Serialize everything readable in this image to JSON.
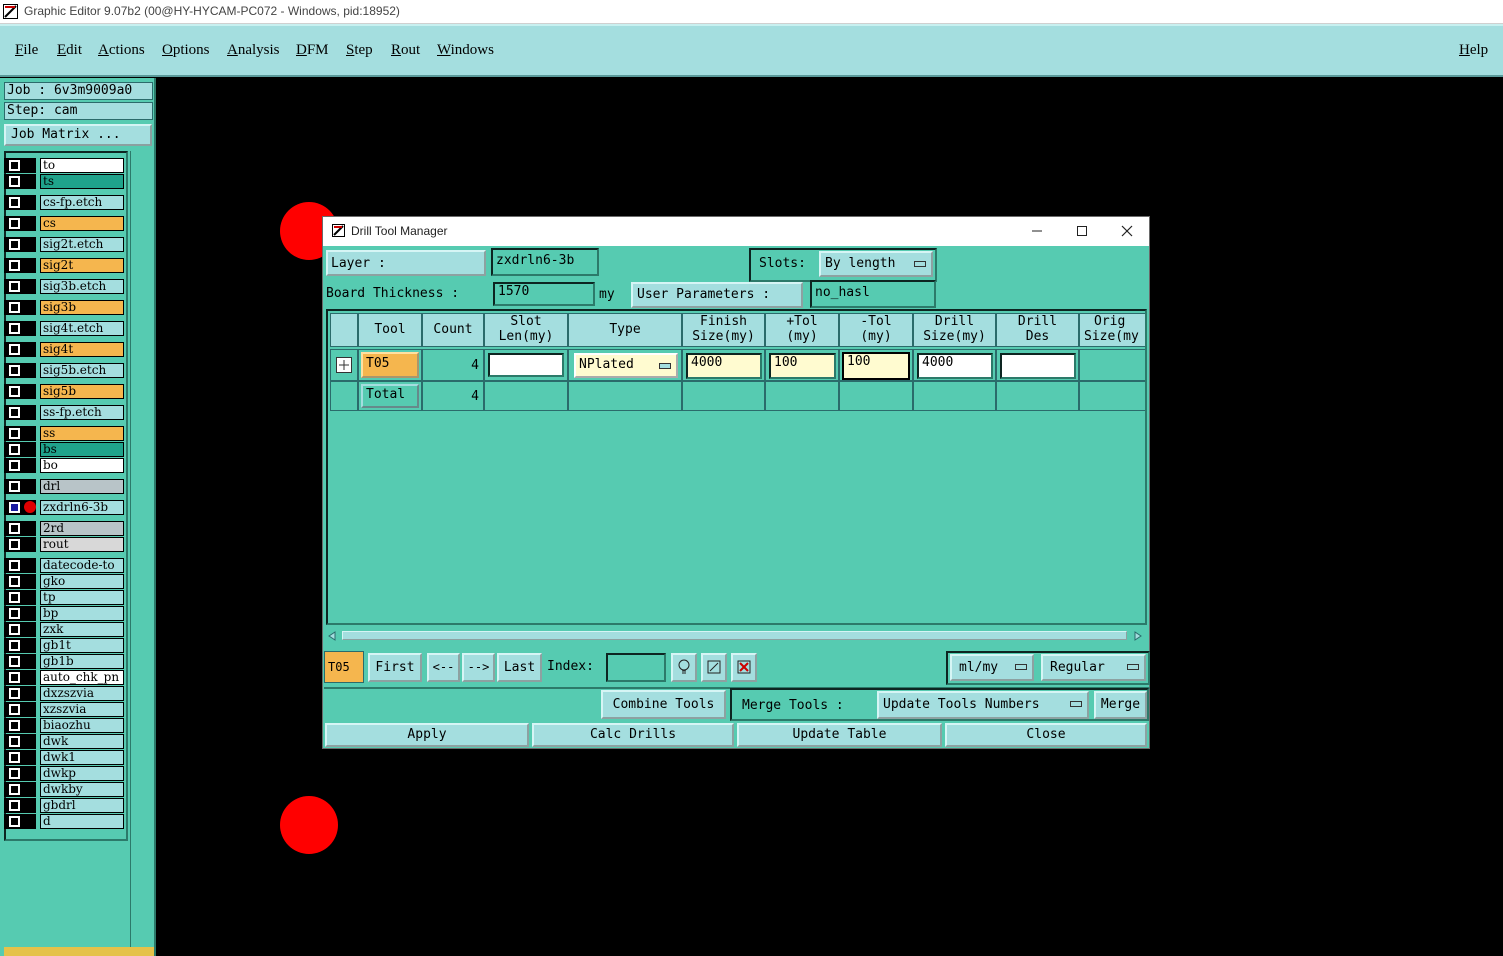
{
  "window": {
    "title": "Graphic Editor 9.07b2 (00@HY-HYCAM-PC072 - Windows, pid:18952)"
  },
  "menubar": {
    "items": [
      "File",
      "Edit",
      "Actions",
      "Options",
      "Analysis",
      "DFM",
      "Step",
      "Rout",
      "Windows"
    ],
    "help": "Help"
  },
  "left_panel": {
    "job": "Job : 6v3m9009a0",
    "step": "Step: cam",
    "job_matrix": "Job Matrix ..."
  },
  "layers": [
    {
      "name": "to",
      "color": "#ffffff"
    },
    {
      "name": "ts",
      "color": "#1fa38b"
    },
    {
      "name": "cs-fp.etch",
      "color": "#a4dedf"
    },
    {
      "name": "cs",
      "color": "#f5b64e"
    },
    {
      "name": "sig2t.etch",
      "color": "#a4dedf"
    },
    {
      "name": "sig2t",
      "color": "#f5b64e"
    },
    {
      "name": "sig3b.etch",
      "color": "#a4dedf"
    },
    {
      "name": "sig3b",
      "color": "#f5b64e"
    },
    {
      "name": "sig4t.etch",
      "color": "#a4dedf"
    },
    {
      "name": "sig4t",
      "color": "#f5b64e"
    },
    {
      "name": "sig5b.etch",
      "color": "#a4dedf"
    },
    {
      "name": "sig5b",
      "color": "#f5b64e"
    },
    {
      "name": "ss-fp.etch",
      "color": "#a4dedf"
    },
    {
      "name": "ss",
      "color": "#f5b64e"
    },
    {
      "name": "bs",
      "color": "#1fa38b"
    },
    {
      "name": "bo",
      "color": "#ffffff"
    },
    {
      "name": "drl",
      "color": "#b8c4c8"
    },
    {
      "name": "zxdrln6-3b",
      "color": "#a4dedf",
      "active": true
    },
    {
      "name": "2rd",
      "color": "#b8c4c8"
    },
    {
      "name": "rout",
      "color": "#d8d8d8"
    },
    {
      "name": "datecode-to",
      "color": "#a4dedf"
    },
    {
      "name": "gko",
      "color": "#a4dedf"
    },
    {
      "name": "tp",
      "color": "#a4dedf"
    },
    {
      "name": "bp",
      "color": "#a4dedf"
    },
    {
      "name": "zxk",
      "color": "#a4dedf"
    },
    {
      "name": "gb1t",
      "color": "#a4dedf"
    },
    {
      "name": "gb1b",
      "color": "#a4dedf"
    },
    {
      "name": "auto_chk_pn",
      "color": "#ffffff"
    },
    {
      "name": "dxzszvia",
      "color": "#a4dedf"
    },
    {
      "name": "xzszvia",
      "color": "#a4dedf"
    },
    {
      "name": "biaozhu",
      "color": "#a4dedf"
    },
    {
      "name": "dwk",
      "color": "#a4dedf"
    },
    {
      "name": "dwk1",
      "color": "#a4dedf"
    },
    {
      "name": "dwkp",
      "color": "#a4dedf"
    },
    {
      "name": "dwkby",
      "color": "#a4dedf"
    },
    {
      "name": "gbdrl",
      "color": "#a4dedf"
    },
    {
      "name": "d",
      "color": "#a4dedf"
    }
  ],
  "dialog": {
    "title": "Drill Tool Manager",
    "layer_label": "Layer :",
    "layer_value": "zxdrln6-3b",
    "slots_label": "Slots:",
    "slots_value": "By length",
    "board_thickness_label": "Board Thickness :",
    "board_thickness_value": "1570",
    "board_thickness_unit": "my",
    "user_params_label": "User Parameters :",
    "user_params_value": "no_hasl",
    "columns": [
      {
        "l1": "Tool",
        "l2": ""
      },
      {
        "l1": "Count",
        "l2": ""
      },
      {
        "l1": "Slot",
        "l2": "Len(my)"
      },
      {
        "l1": "Type",
        "l2": ""
      },
      {
        "l1": "Finish",
        "l2": "Size(my)"
      },
      {
        "l1": "+Tol",
        "l2": "(my)"
      },
      {
        "l1": "-Tol",
        "l2": "(my)"
      },
      {
        "l1": "Drill",
        "l2": "Size(my)"
      },
      {
        "l1": "Drill",
        "l2": "Des"
      },
      {
        "l1": "Orig",
        "l2": "Size(my"
      }
    ],
    "row": {
      "tool": "T05",
      "count": "4",
      "slot_len": "",
      "type": "NPlated",
      "finish": "4000",
      "plus_tol": "100",
      "minus_tol": "100",
      "drill_size": "4000",
      "drill_des": ""
    },
    "total": {
      "label": "Total",
      "count": "4"
    },
    "nav": {
      "current": "T05",
      "first": "First",
      "prev": "<--",
      "next": "-->",
      "last": "Last",
      "index_label": "Index:",
      "index_value": "",
      "units": "ml/my",
      "mode": "Regular"
    },
    "combine_tools": "Combine Tools",
    "merge_tools_label": "Merge Tools :",
    "merge_tools_value": "Update Tools Numbers",
    "merge_button": "Merge",
    "apply": "Apply",
    "calc_drills": "Calc Drills",
    "update_table": "Update Table",
    "close": "Close"
  }
}
